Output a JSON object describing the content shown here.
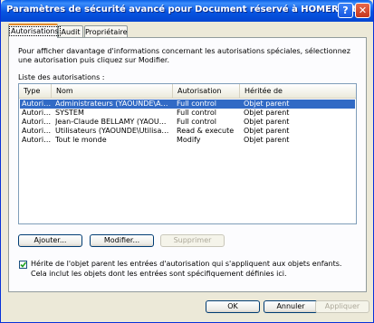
{
  "window": {
    "title": "Paramètres de sécurité avancé pour Document réservé à HOMER.txt",
    "help_label": "?",
    "close_label": "✕"
  },
  "tabs": [
    {
      "label": "Autorisations",
      "active": true
    },
    {
      "label": "Audit",
      "active": false
    },
    {
      "label": "Propriétaire",
      "active": false
    }
  ],
  "panel": {
    "intro": "Pour afficher davantage d'informations concernant les autorisations spéciales, sélectionnez une autorisation puis cliquez sur Modifier.",
    "list_label": "Liste des autorisations :",
    "columns": [
      "Type",
      "Nom",
      "Autorisation",
      "Héritée de"
    ],
    "rows": [
      {
        "type": "Autoriser",
        "name": "Administrateurs (YAOUNDE\\Ad...",
        "permission": "Full control",
        "inherited": "Objet parent",
        "selected": true
      },
      {
        "type": "Autoriser",
        "name": "SYSTEM",
        "permission": "Full control",
        "inherited": "Objet parent",
        "selected": false
      },
      {
        "type": "Autoriser",
        "name": "Jean-Claude BELLAMY (YAOU...",
        "permission": "Full control",
        "inherited": "Objet parent",
        "selected": false
      },
      {
        "type": "Autoriser",
        "name": "Utilisateurs (YAOUNDE\\Utilisate...",
        "permission": "Read & execute",
        "inherited": "Objet parent",
        "selected": false
      },
      {
        "type": "Autoriser",
        "name": "Tout le monde",
        "permission": "Modify",
        "inherited": "Objet parent",
        "selected": false
      }
    ],
    "add_label": "Ajouter...",
    "edit_label": "Modifier...",
    "remove_label": "Supprimer",
    "inherit_checked": true,
    "inherit_text": "Hérite de l'objet parent les entrées d'autorisation qui s'appliquent aux objets enfants. Cela inclut les objets dont les entrées sont spécifiquement définies ici."
  },
  "footer": {
    "ok_label": "OK",
    "cancel_label": "Annuler",
    "apply_label": "Appliquer"
  },
  "colors": {
    "titlebar": "#0754e0",
    "selection": "#316ac5",
    "active_tab_accent": "#e68b2c",
    "check_green": "#21a121"
  }
}
